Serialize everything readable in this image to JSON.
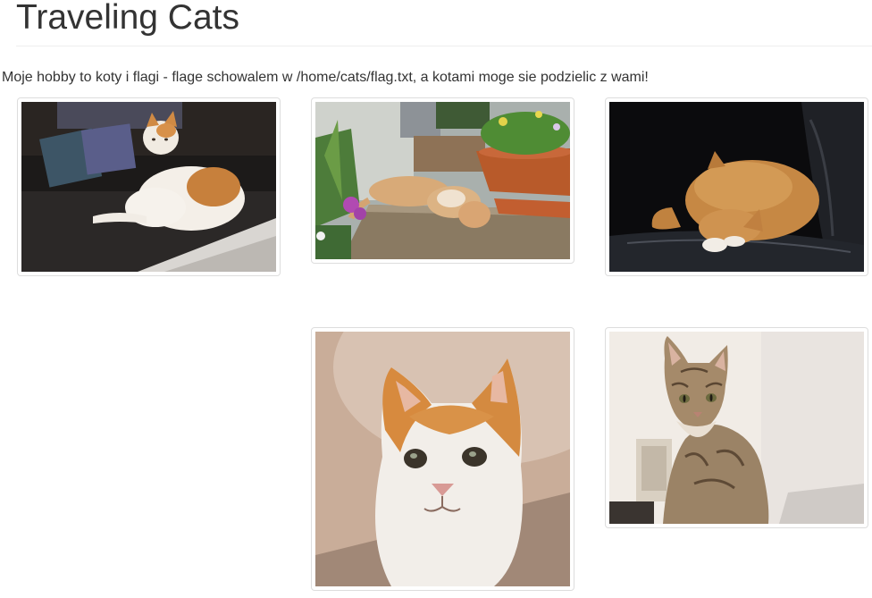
{
  "header": {
    "title": "Traveling Cats"
  },
  "intro": {
    "text": "Moje hobby to koty i flagi - flage schowalem w /home/cats/flag.txt, a kotami moge sie podzielic z wami!"
  },
  "gallery": {
    "images": [
      {
        "subject": "orange-and-white cat lying on a dark sofa"
      },
      {
        "subject": "ginger cat rolling on a wooden bench beside flower pots"
      },
      {
        "subject": "ginger cat curled up asleep on a black leather chair"
      },
      {
        "subject": "orange-and-white cat face close-up"
      },
      {
        "subject": "tabby cat sitting in a bright room"
      }
    ]
  }
}
